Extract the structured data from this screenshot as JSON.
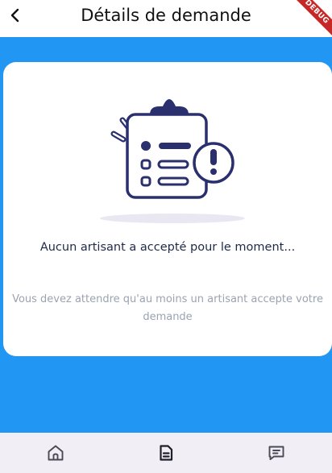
{
  "appbar": {
    "title": "Détails de demande",
    "back_icon": "chevron-left-icon",
    "debug_banner": "DEBUG"
  },
  "empty_state": {
    "illustration": "clipboard-list-alert-icon",
    "title": "Aucun artisant a accepté pour le moment...",
    "description": "Vous devez attendre qu'au moins un artisant accepte votre demande"
  },
  "bottom_nav": {
    "items": [
      {
        "icon": "home-icon",
        "active": false
      },
      {
        "icon": "document-icon",
        "active": true
      },
      {
        "icon": "chat-icon",
        "active": false
      }
    ]
  },
  "colors": {
    "background": "#2196F3",
    "accent": "#2a2f6e",
    "card": "#ffffff",
    "nav_background": "#f1eff5"
  }
}
